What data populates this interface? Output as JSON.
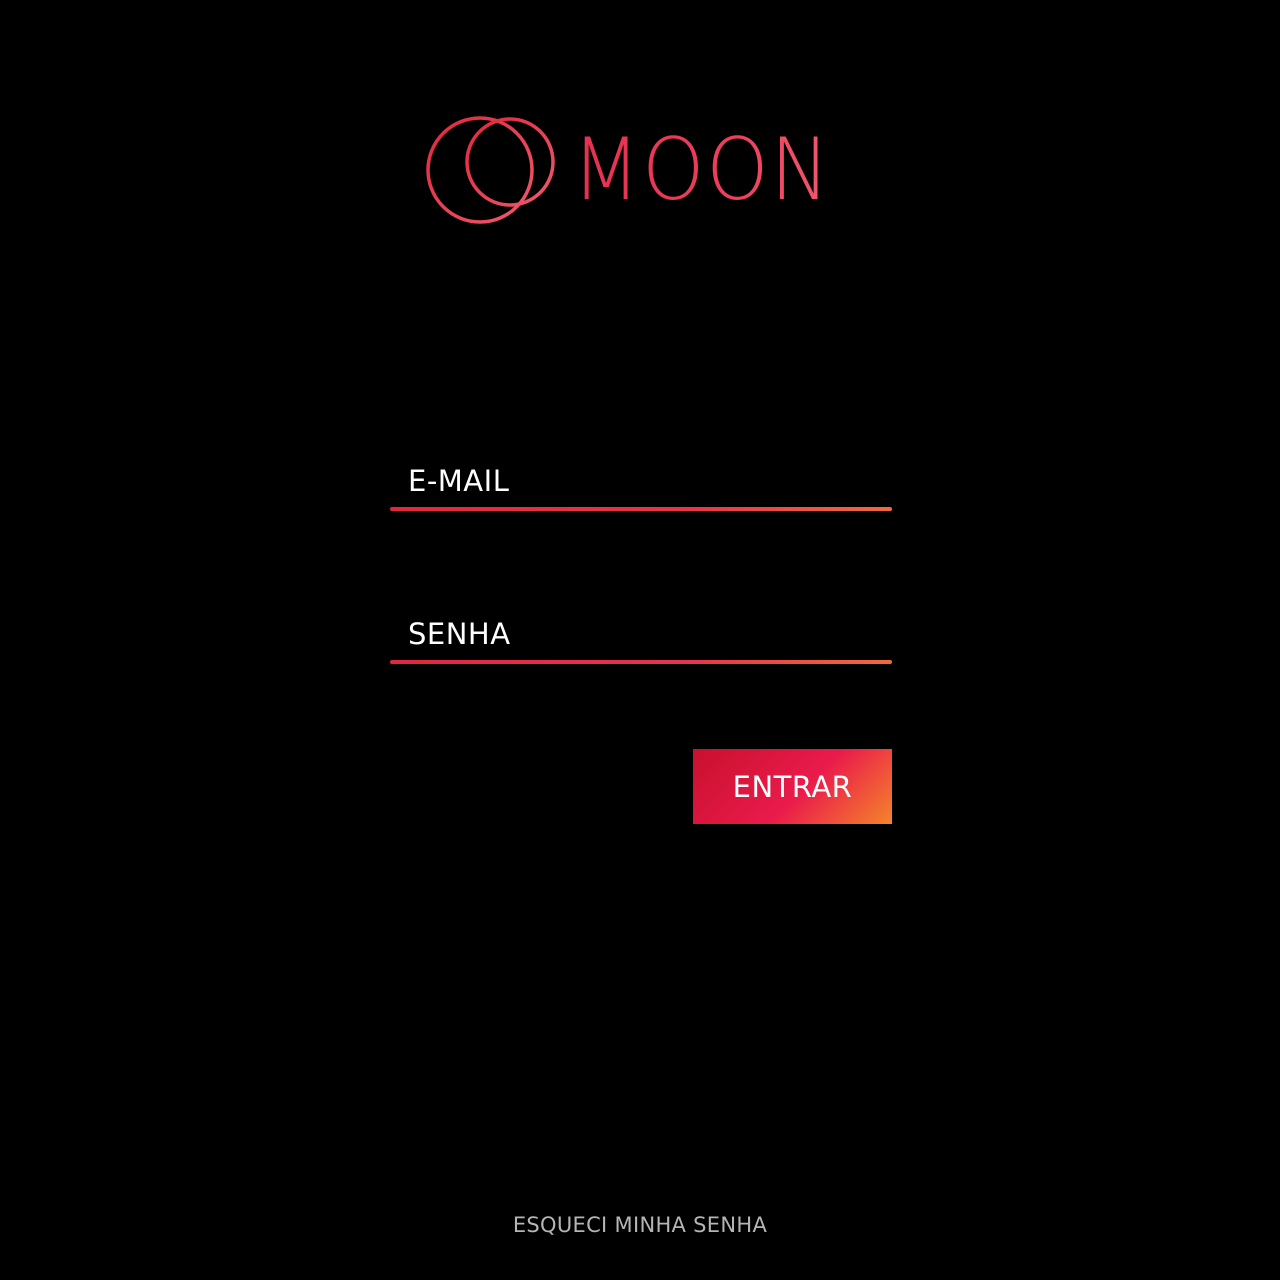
{
  "brand": {
    "name": "MOON",
    "logo_icon": "overlapping-circles-icon",
    "colors": {
      "primary": "#e8354a",
      "accent_orange": "#f5842b",
      "accent_red": "#c8102e",
      "background": "#000000"
    }
  },
  "login_form": {
    "email_placeholder": "E-MAIL",
    "email_value": "",
    "password_placeholder": "SENHA",
    "password_value": "",
    "submit_label": "ENTRAR"
  },
  "footer": {
    "forgot_password_label": "ESQUECI MINHA SENHA"
  }
}
